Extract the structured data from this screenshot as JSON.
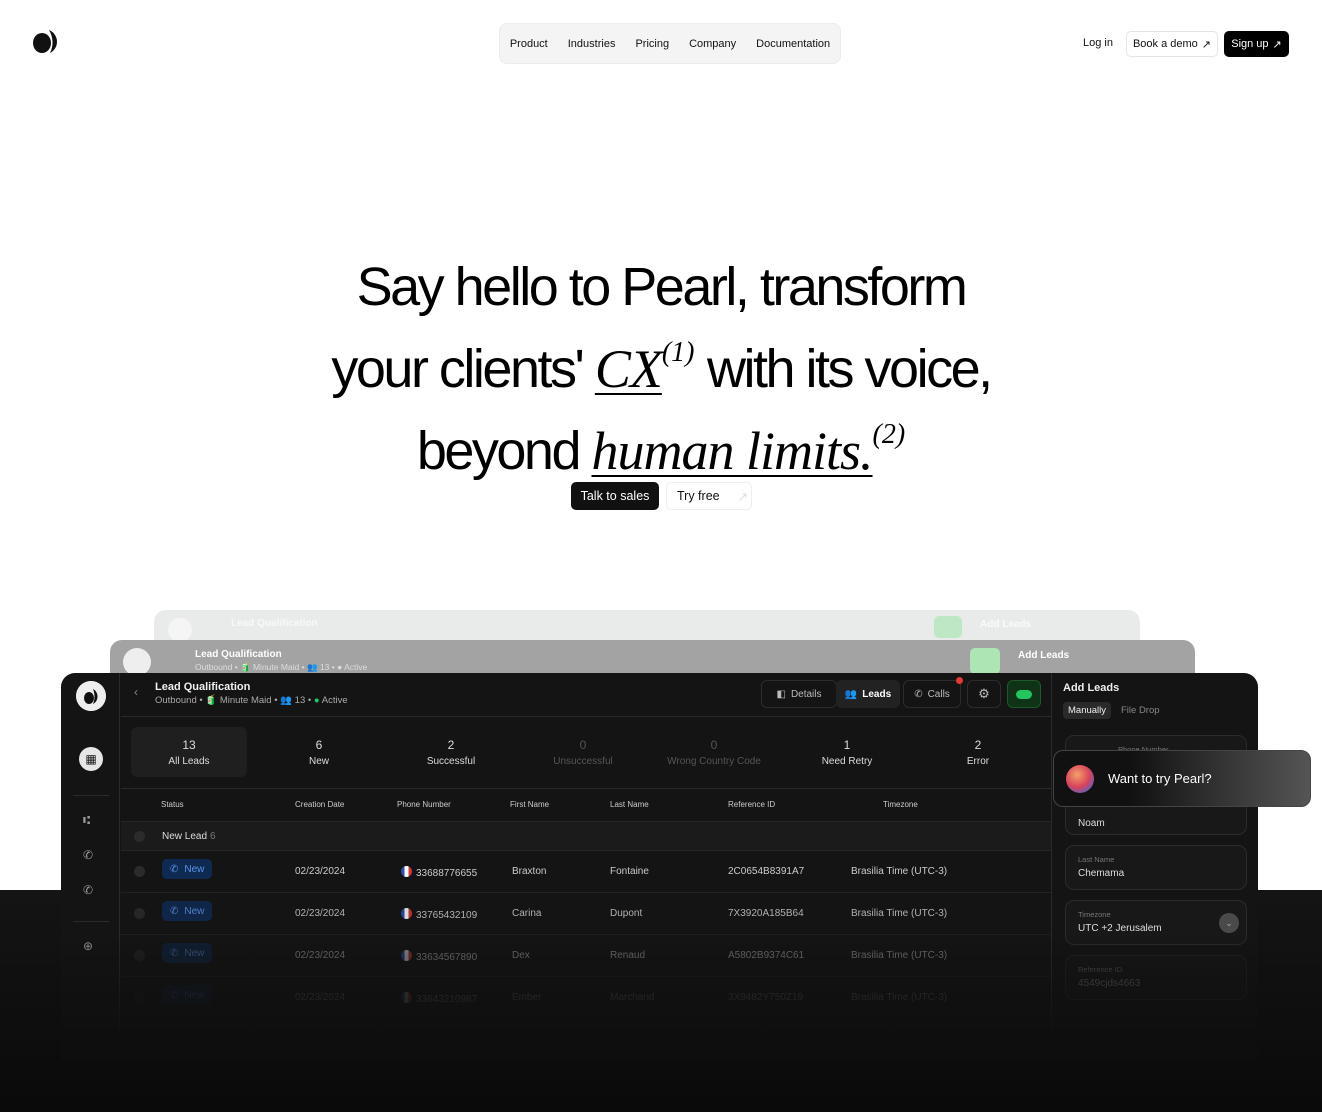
{
  "nav": {
    "logo": "pearl-logo",
    "items": [
      "Product",
      "Industries",
      "Pricing",
      "Company",
      "Documentation"
    ],
    "login": "Log in",
    "book_demo": "Book a demo",
    "signup": "Sign up"
  },
  "hero": {
    "line1": "Say hello to Pearl, transform",
    "line2_a": "your clients'",
    "line2_em": "CX",
    "line2_sup": "(1)",
    "line2_b": "with its voice,",
    "line3_a": "beyond",
    "line3_em": "human limits.",
    "line3_sup": "(2)",
    "cta_primary": "Talk to sales",
    "cta_secondary": "Try free"
  },
  "dashboard": {
    "title": "Lead Qualification",
    "subtitle": "Outbound • 🧃 Minute Maid • 👥 13 • ● Active",
    "sub_parts": {
      "type": "Outbound",
      "client": "Minute Maid",
      "count": "13",
      "status": "Active"
    },
    "tabs": {
      "details": "Details",
      "leads": "Leads",
      "calls": "Calls"
    },
    "accent_green": "#22c55e",
    "stats": [
      {
        "value": "13",
        "label": "All Leads"
      },
      {
        "value": "6",
        "label": "New"
      },
      {
        "value": "2",
        "label": "Successful"
      },
      {
        "value": "0",
        "label": "Unsuccessful"
      },
      {
        "value": "0",
        "label": "Wrong Country Code"
      },
      {
        "value": "1",
        "label": "Need Retry"
      },
      {
        "value": "2",
        "label": "Error"
      }
    ],
    "columns": [
      "Status",
      "Creation Date",
      "Phone Number",
      "First Name",
      "Last Name",
      "Reference ID",
      "Timezone"
    ],
    "group": {
      "label": "New Lead",
      "count": "6"
    },
    "rows": [
      {
        "status": "New",
        "date": "02/23/2024",
        "phone": "33688776655",
        "first": "Braxton",
        "last": "Fontaine",
        "ref": "2C0654B8391A7",
        "tz": "Brasilia Time (UTC-3)"
      },
      {
        "status": "New",
        "date": "02/23/2024",
        "phone": "33765432109",
        "first": "Carina",
        "last": "Dupont",
        "ref": "7X3920A185B64",
        "tz": "Brasilia Time (UTC-3)"
      },
      {
        "status": "New",
        "date": "02/23/2024",
        "phone": "33634567890",
        "first": "Dex",
        "last": "Renaud",
        "ref": "A5802B9374C61",
        "tz": "Brasilia Time (UTC-3)"
      },
      {
        "status": "New",
        "date": "02/23/2024",
        "phone": "33643210987",
        "first": "Ember",
        "last": "Marchand",
        "ref": "3X9482Y750Z19",
        "tz": "Brasilia Time (UTC-3)"
      }
    ],
    "add_leads": {
      "title": "Add Leads",
      "tab_manual": "Manually",
      "tab_file": "File Drop",
      "phone_label": "Phone Number",
      "first_value": "Noam",
      "last_label": "Last Name",
      "last_value": "Chemama",
      "tz_label": "Timezone",
      "tz_value": "UTC +2 Jerusalem",
      "ref_label": "Reference ID",
      "ref_value": "4549cjds4663"
    }
  },
  "toast": {
    "text": "Want to try Pearl?"
  }
}
